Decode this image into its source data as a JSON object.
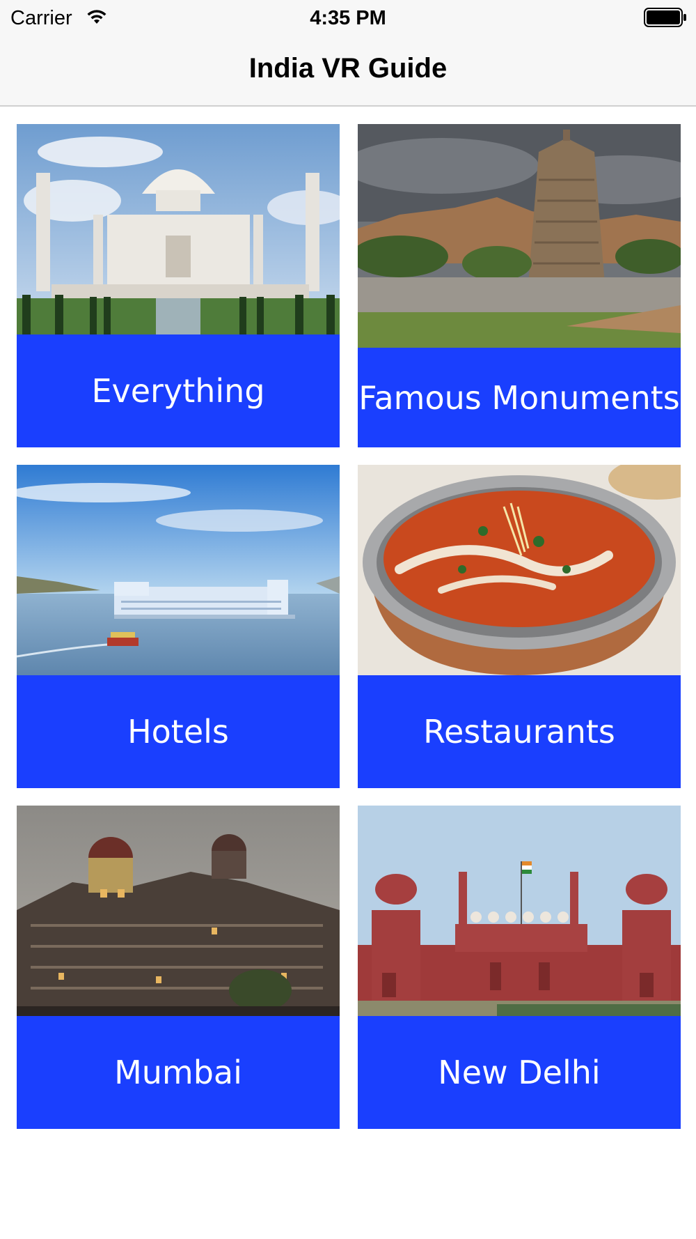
{
  "status_bar": {
    "carrier": "Carrier",
    "time": "4:35 PM",
    "wifi_icon": "wifi-icon",
    "battery_icon": "battery-full-icon"
  },
  "nav": {
    "title": "India VR Guide"
  },
  "accent_color": "#1a3ffe",
  "categories": [
    {
      "label": "Everything",
      "image": "taj-mahal-photo"
    },
    {
      "label": "Famous Monuments",
      "image": "hampi-temple-photo"
    },
    {
      "label": "Hotels",
      "image": "lake-palace-photo"
    },
    {
      "label": "Restaurants",
      "image": "curry-bowl-photo"
    },
    {
      "label": "Mumbai",
      "image": "taj-hotel-mumbai-photo"
    },
    {
      "label": "New Delhi",
      "image": "red-fort-photo"
    }
  ]
}
